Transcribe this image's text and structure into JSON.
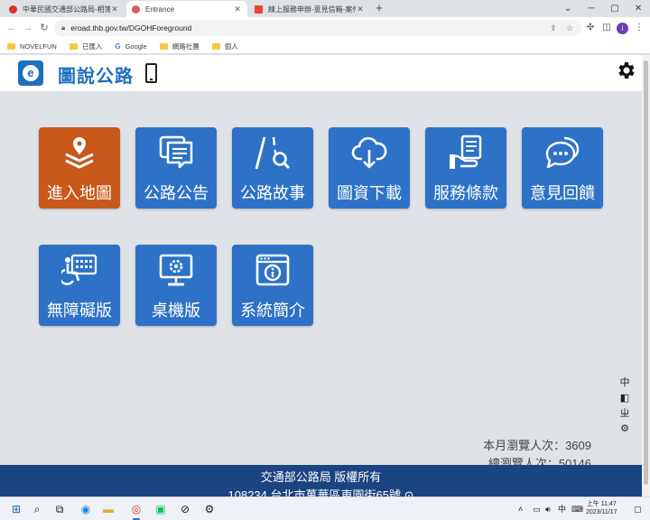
{
  "browser": {
    "tabs": [
      {
        "title": "中華民國交通部公路局-相簿網頁…",
        "favicon_color": "#d9342b"
      },
      {
        "title": "Entrance",
        "favicon_color": "#e35b5b"
      },
      {
        "title": "線上服務申辦-意見信箱-案件處…",
        "favicon_color": "#ea4335"
      }
    ],
    "new_tab": "+",
    "url": "eroad.thb.gov.tw/DGOHForeground",
    "bookmarks": [
      "NOVELFUN",
      "已匯入",
      "Google",
      "網路社團",
      "個人"
    ],
    "profile_initial": "i"
  },
  "site": {
    "title": "圖說公路",
    "tiles": [
      {
        "label": "進入地圖",
        "icon": "map-pin-layers-icon"
      },
      {
        "label": "公路公告",
        "icon": "announcement-chat-icon"
      },
      {
        "label": "公路故事",
        "icon": "road-search-icon"
      },
      {
        "label": "圖資下載",
        "icon": "cloud-download-icon"
      },
      {
        "label": "服務條款",
        "icon": "document-hand-icon"
      },
      {
        "label": "意見回饋",
        "icon": "feedback-bubble-icon"
      },
      {
        "label": "無障礙版",
        "icon": "accessibility-keyboard-icon"
      },
      {
        "label": "桌機版",
        "icon": "desktop-gear-icon"
      },
      {
        "label": "系統簡介",
        "icon": "info-window-icon"
      }
    ],
    "side_tools": [
      "中",
      "◧",
      "ㄓ",
      "⚙"
    ],
    "visits_month": "本月瀏覽人次：3609",
    "visits_total": "總瀏覽人次：50146",
    "footer_line1": "交通部公路局 版權所有",
    "footer_line2": "108234 台北市萬華區東園街65號"
  },
  "taskbar": {
    "time": "上午 11:47",
    "date": "2023/11/17",
    "ime": "中"
  },
  "colors": {
    "tile_blue": "#2d72c6",
    "tile_active": "#c8571a",
    "footer": "#1c4483",
    "brand": "#1f6fc0"
  }
}
